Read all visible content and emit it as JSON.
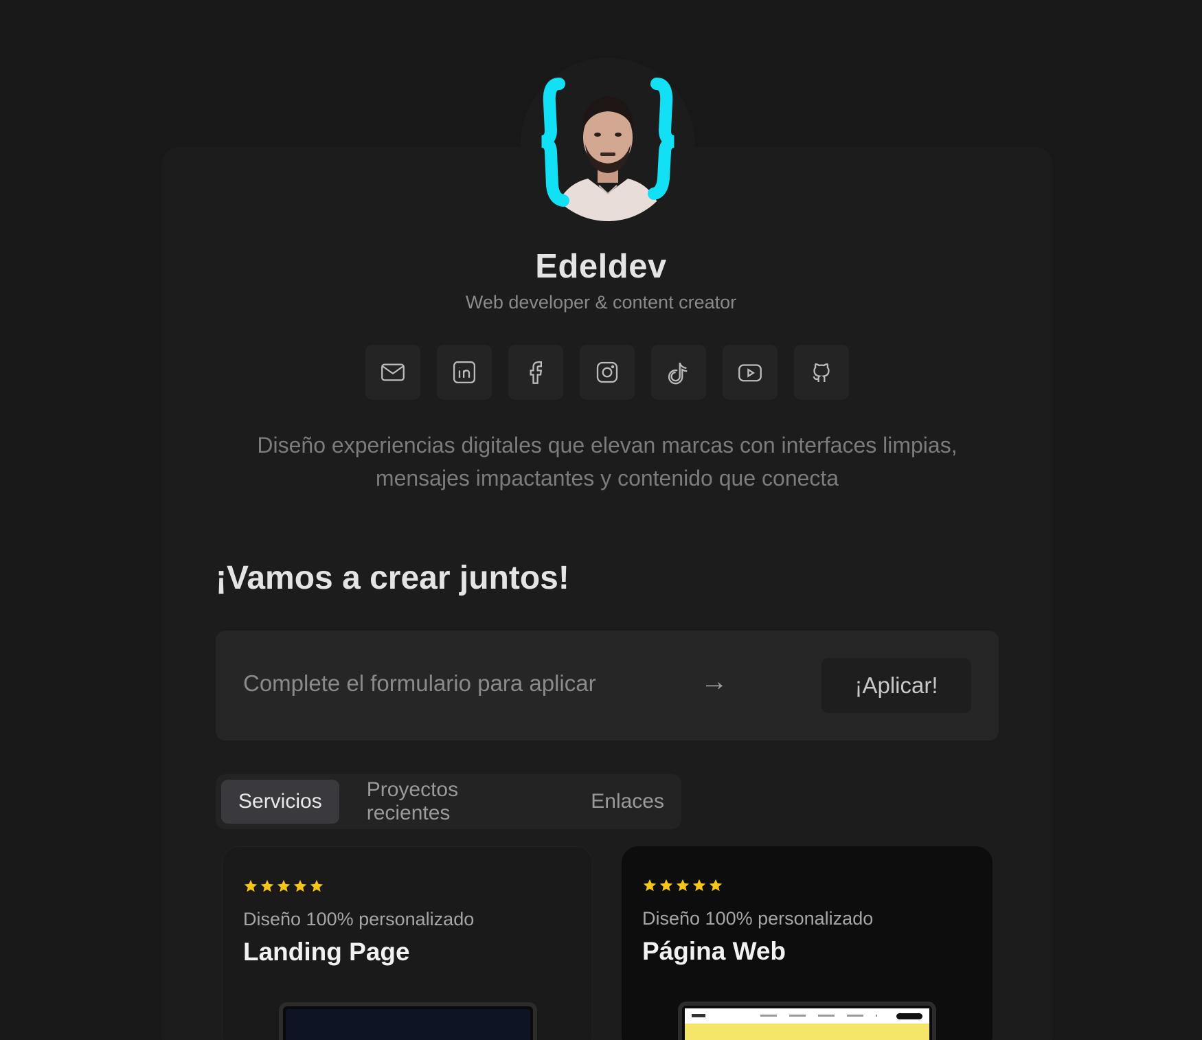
{
  "profile": {
    "name": "Edeldev",
    "subtitle": "Web developer & content creator",
    "bio": "Diseño experiencias digitales que elevan marcas con interfaces limpias, mensajes impactantes y contenido que conecta"
  },
  "socials": [
    {
      "icon": "mail-icon"
    },
    {
      "icon": "linkedin-icon"
    },
    {
      "icon": "facebook-icon"
    },
    {
      "icon": "instagram-icon"
    },
    {
      "icon": "tiktok-icon"
    },
    {
      "icon": "youtube-icon"
    },
    {
      "icon": "github-icon"
    }
  ],
  "cta": {
    "title": "¡Vamos a crear juntos!",
    "form_text": "Complete el formulario para aplicar",
    "arrow": "→",
    "button_label": "¡Aplicar!"
  },
  "tabs": [
    {
      "label": "Servicios",
      "active": true
    },
    {
      "label": "Proyectos recientes",
      "active": false
    },
    {
      "label": "Enlaces",
      "active": false
    }
  ],
  "services": [
    {
      "rating": 5,
      "subtitle": "Diseño 100% personalizado",
      "title": "Landing Page"
    },
    {
      "rating": 5,
      "subtitle": "Diseño 100% personalizado",
      "title": "Página Web"
    }
  ],
  "colors": {
    "background": "#181818",
    "card": "#1c1c1c",
    "accent_cyan": "#12e0f5",
    "star": "#f5c518"
  }
}
